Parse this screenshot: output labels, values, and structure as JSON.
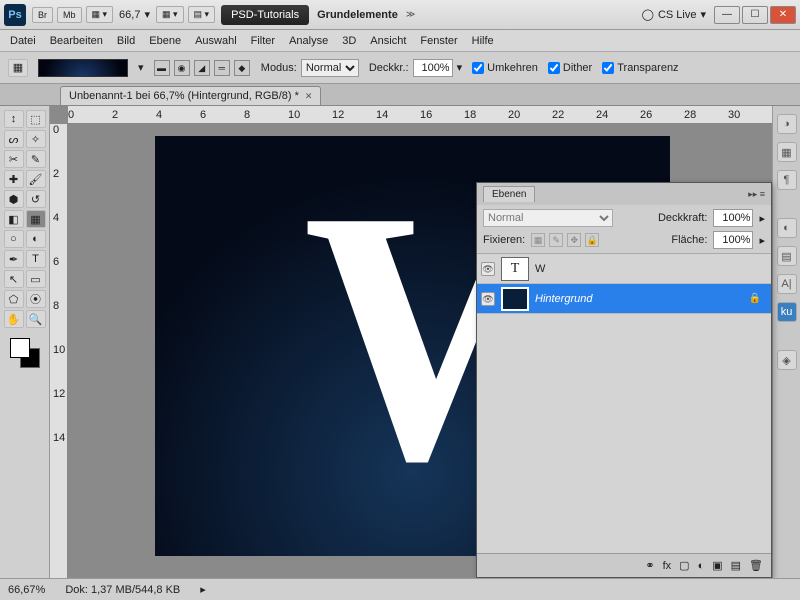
{
  "titlebar": {
    "br": "Br",
    "mb": "Mb",
    "zoom_label": "66,7",
    "workspace_tab": "PSD-Tutorials",
    "workspace_tab2": "Grundelemente",
    "cs_live": "CS Live"
  },
  "menu": [
    "Datei",
    "Bearbeiten",
    "Bild",
    "Ebene",
    "Auswahl",
    "Filter",
    "Analyse",
    "3D",
    "Ansicht",
    "Fenster",
    "Hilfe"
  ],
  "options": {
    "modus_label": "Modus:",
    "modus_value": "Normal",
    "deck_label": "Deckkr.:",
    "deck_value": "100%",
    "chk_umkehren": "Umkehren",
    "chk_dither": "Dither",
    "chk_transparenz": "Transparenz"
  },
  "doctab": {
    "title": "Unbenannt-1 bei 66,7% (Hintergrund, RGB/8) *"
  },
  "canvas": {
    "big_letter": "W"
  },
  "layers_panel": {
    "title": "Ebenen",
    "mode": "Normal",
    "opacity_label": "Deckkraft:",
    "opacity_value": "100%",
    "lock_label": "Fixieren:",
    "fill_label": "Fläche:",
    "fill_value": "100%",
    "layers": [
      {
        "name": "W",
        "type": "text"
      },
      {
        "name": "Hintergrund",
        "type": "bg",
        "selected": true,
        "locked": true
      }
    ]
  },
  "status": {
    "zoom": "66,67%",
    "doc": "Dok: 1,37 MB/544,8 KB"
  },
  "ruler_h": [
    "0",
    "2",
    "4",
    "6",
    "8",
    "10",
    "12",
    "14",
    "16",
    "18",
    "20",
    "22",
    "24",
    "26",
    "28",
    "30"
  ],
  "ruler_v": [
    "0",
    "2",
    "4",
    "6",
    "8",
    "10",
    "12",
    "14"
  ]
}
